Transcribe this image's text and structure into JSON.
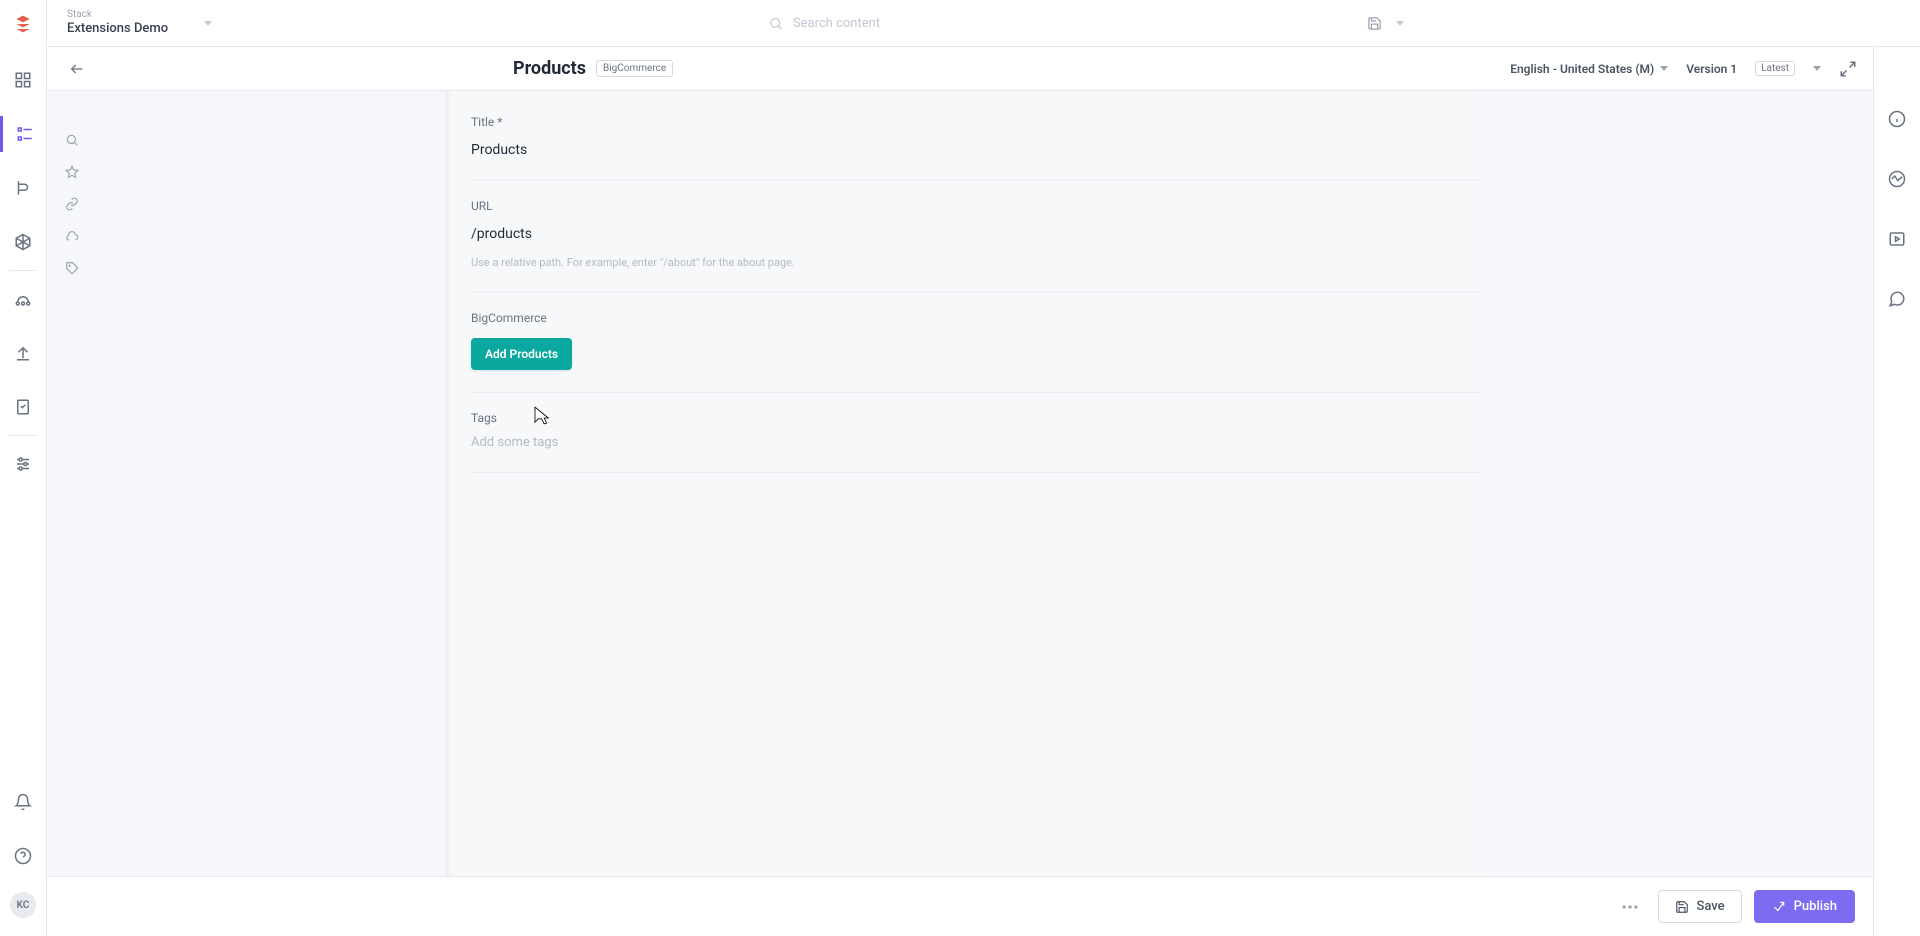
{
  "stack": {
    "label": "Stack",
    "name": "Extensions Demo"
  },
  "search": {
    "placeholder": "Search content"
  },
  "entry": {
    "title": "Products",
    "content_type_badge": "BigCommerce",
    "locale": "English - United States (M)",
    "version": "Version 1",
    "version_badge": "Latest"
  },
  "fields": {
    "title": {
      "label": "Title",
      "required_mark": "*",
      "value": "Products"
    },
    "url": {
      "label": "URL",
      "value": "/products",
      "help": "Use a relative path. For example, enter \"/about\" for the about page."
    },
    "bigcommerce": {
      "label": "BigCommerce",
      "button": "Add Products"
    },
    "tags": {
      "label": "Tags",
      "placeholder": "Add some tags"
    }
  },
  "footer": {
    "save": "Save",
    "publish": "Publish"
  },
  "avatar": "KC"
}
